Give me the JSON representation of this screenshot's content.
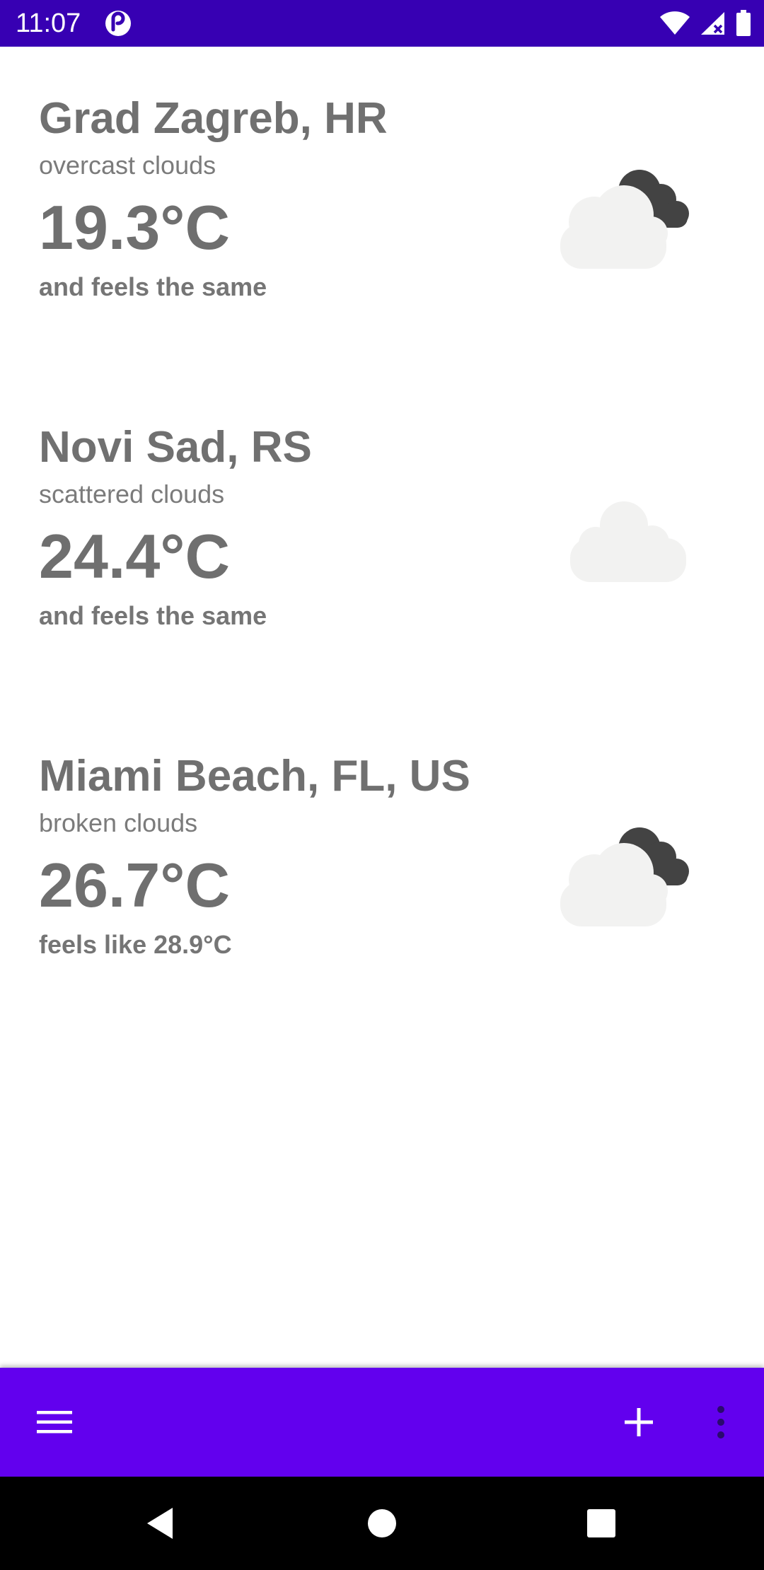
{
  "status_bar": {
    "time": "11:07",
    "icons": [
      "app-notification-icon",
      "wifi-icon",
      "cellular-signal-icon",
      "battery-icon"
    ],
    "background_color": "#3700b3"
  },
  "weather": [
    {
      "city": "Grad Zagreb, HR",
      "description": "overcast clouds",
      "temperature": "19.3°C",
      "feels_like": "and feels the same",
      "icon": "cloud-with-dark-cloud-icon"
    },
    {
      "city": "Novi Sad, RS",
      "description": "scattered clouds",
      "temperature": "24.4°C",
      "feels_like": "and feels the same",
      "icon": "cloud-icon"
    },
    {
      "city": "Miami Beach, FL, US",
      "description": "broken clouds",
      "temperature": "26.7°C",
      "feels_like": "feels like 28.9°C",
      "icon": "cloud-with-dark-cloud-icon"
    }
  ],
  "bottom_bar": {
    "background_color": "#6200ee",
    "icons": [
      "hamburger-menu-icon",
      "add-icon",
      "more-vertical-icon"
    ]
  },
  "nav_bar": {
    "icons": [
      "back-icon",
      "home-icon",
      "recents-icon"
    ]
  },
  "colors": {
    "text_primary": "#707070",
    "cloud_light": "#f2f2f1",
    "cloud_dark": "#434343"
  }
}
